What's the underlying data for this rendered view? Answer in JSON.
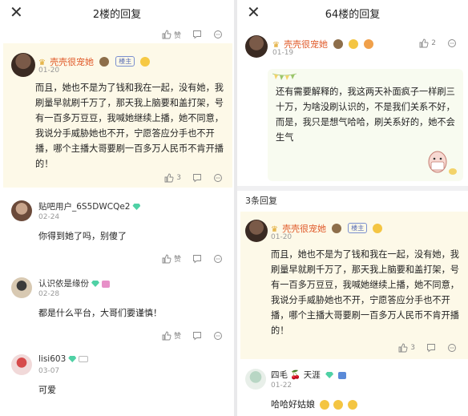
{
  "left": {
    "close_icon": "close-icon",
    "title": "2楼的回复",
    "toolbar_top": {
      "like_label": "赞"
    },
    "post": {
      "username": "壳壳很宠她",
      "owner_badge": "楼主",
      "date": "01-20",
      "text": "而且，她也不是为了钱和我在一起，没有她，我刷量早就刷千万了，那天我上脑要和盖打架，号有一百多万豆豆，我喊她继续上播，她不同意，我说分手威胁她也不开，宁愿答应分手也不开播，哪个主播大哥要刷一百多万人民币不肯开播的！",
      "likes": "3"
    },
    "replies": [
      {
        "username": "贴吧用户_6S5DWCQe2",
        "date": "02-24",
        "text": "你得到她了吗，别傻了",
        "like_label": "赞"
      },
      {
        "username": "认识依是缘份",
        "date": "02-28",
        "text": "都是什么平台，大哥们要谨慎！",
        "like_label": "赞"
      },
      {
        "username": "lisi603",
        "date": "03-07",
        "text": "可爱",
        "like_label": "赞"
      }
    ]
  },
  "right": {
    "close_icon": "close-icon",
    "title": "64楼的回复",
    "post": {
      "username": "壳壳很宠她",
      "date": "01-19",
      "likes": "2",
      "text": "还有需要解释的，我这两天补面疯子一样刷三十万，为啥没刷认识的，不是我们关系不好，而是，我只是想气哈哈，刷关系好的，她不会生气"
    },
    "reply_count": "3条回复",
    "reply_post": {
      "username": "壳壳很宠她",
      "owner_badge": "楼主",
      "date": "01-20",
      "text": "而且，她也不是为了钱和我在一起，没有她，我刷量早就刷千万了，那天我上脑要和盖打架，号有一百多万豆豆，我喊她继续上播，她不同意，我说分手威胁她也不开，宁愿答应分手也不开播，哪个主播大哥要刷一百多万人民币不肯开播的！",
      "likes": "3"
    },
    "reply": {
      "username_a": "四毛",
      "username_b": "天涯",
      "date": "01-22",
      "text": "哈哈好姑娘"
    }
  }
}
